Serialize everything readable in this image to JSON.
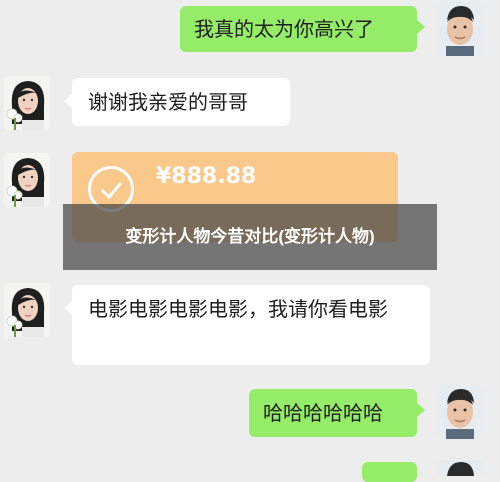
{
  "messages": [
    {
      "side": "right",
      "text": "我真的太为你高兴了"
    },
    {
      "side": "left",
      "text": "谢谢我亲爱的哥哥"
    },
    {
      "side": "left",
      "type": "transfer",
      "amount": "¥888.88"
    },
    {
      "side": "left",
      "text": "电影电影电影电影，我请你看电影"
    },
    {
      "side": "right",
      "text": "哈哈哈哈哈哈"
    }
  ],
  "overlay_caption": "变形计人物今昔对比(变形计人物)",
  "colors": {
    "background": "#ededed",
    "own_bubble": "#95ec69",
    "other_bubble": "#ffffff",
    "transfer_card": "#f9c88a"
  }
}
